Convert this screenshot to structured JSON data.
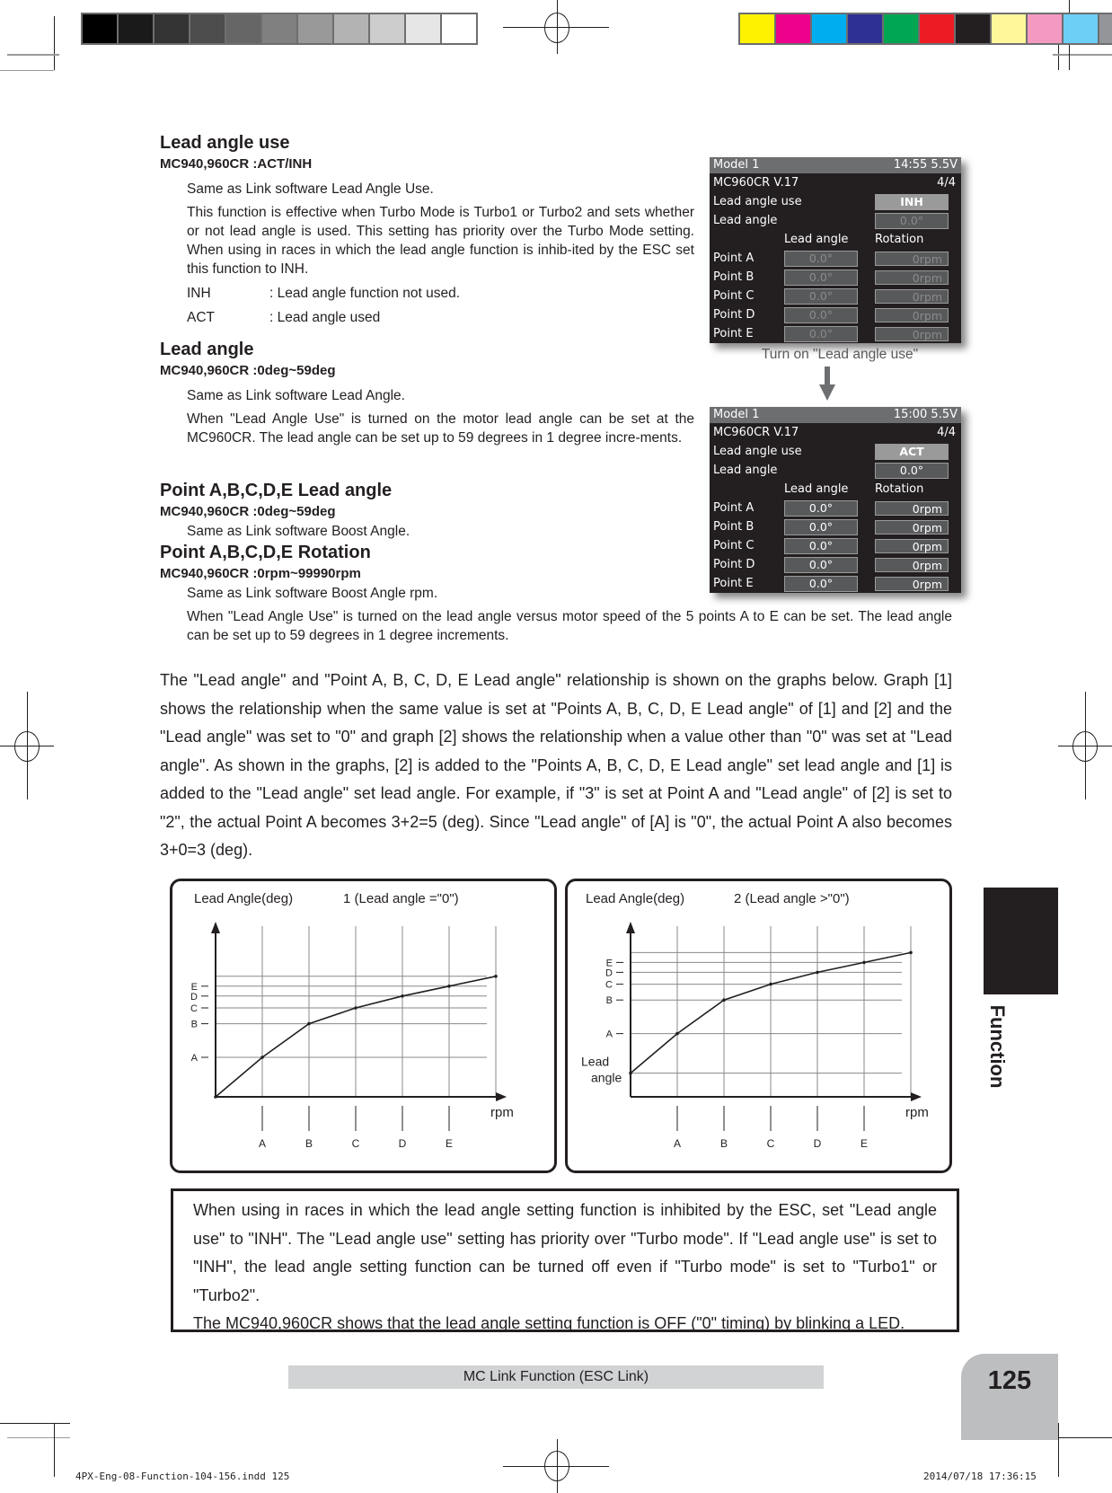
{
  "printer_marks": {
    "gray_steps": [
      "#000000",
      "#1a1a1a",
      "#333333",
      "#4d4d4d",
      "#666666",
      "#808080",
      "#999999",
      "#b3b3b3",
      "#cccccc",
      "#e6e6e6",
      "#ffffff"
    ],
    "color_steps": [
      "#fff200",
      "#ec008c",
      "#00aeef",
      "#2e3192",
      "#00a651",
      "#ed1c24",
      "#231f20",
      "#fff799",
      "#f49ac1",
      "#6dcff6",
      "#939598"
    ]
  },
  "sections": {
    "lead_angle_use": {
      "title": "Lead angle use",
      "spec": "MC940,960CR :ACT/INH",
      "p1": "Same as Link software Lead Angle Use.",
      "p2": "This function is effective when Turbo Mode is Turbo1 or Turbo2 and sets whether or not lead angle is used. This setting has priority over the Turbo Mode setting. When using in races in which the lead angle function is inhib-ited by the ESC set this function to INH.",
      "opt_inh_key": "INH",
      "opt_inh_val": ": Lead angle function not used.",
      "opt_act_key": "ACT",
      "opt_act_val": ": Lead angle used"
    },
    "lead_angle": {
      "title": "Lead angle",
      "spec": "MC940,960CR :0deg~59deg",
      "p1": "Same as Link software Lead Angle.",
      "p2": "When \"Lead Angle Use\" is turned on the motor lead angle can be set at the MC960CR. The lead angle can be set up to 59 degrees in 1 degree incre-ments."
    },
    "point_lead_angle": {
      "title": "Point A,B,C,D,E Lead angle",
      "spec": "MC940,960CR :0deg~59deg",
      "p1": "Same as Link software Boost Angle."
    },
    "point_rotation": {
      "title": "Point A,B,C,D,E Rotation",
      "spec": "MC940,960CR :0rpm~99990rpm",
      "p1": "Same as Link software Boost Angle rpm.",
      "p2": "When \"Lead Angle Use\" is turned on the lead angle versus motor speed of the 5 points A to E can be set. The lead angle can be set up to 59 degrees in 1 degree increments."
    },
    "relationship": "The \"Lead angle\" and \"Point A, B, C, D, E Lead angle\" relationship is shown on the graphs below. Graph [1] shows the relationship when the same value is set at \"Points A, B, C, D, E Lead angle\" of [1] and [2] and the \"Lead angle\" was set to \"0\" and graph [2] shows the relationship when a value other than \"0\" was set at \"Lead angle\". As shown in the graphs, [2] is added to the \"Points A, B, C, D, E Lead angle\" set lead angle and [1] is added to the \"Lead angle\" set lead angle. For example, if \"3\" is set at Point A and \"Lead angle\" of [2] is set to \"2\", the actual Point A  becomes 3+2=5 (deg). Since \"Lead angle\" of [A] is \"0\", the actual Point A also becomes 3+0=3 (deg)."
  },
  "screens": [
    {
      "model": "Model 1",
      "status": "14:55 5.5V",
      "device": "MC960CR V.17",
      "page": "4/4",
      "lead_angle_use_label": "Lead angle use",
      "lead_angle_use_value": "INH",
      "lead_angle_label": "Lead angle",
      "lead_angle_value": "0.0°",
      "col_lead": "Lead angle",
      "col_rot": "Rotation",
      "points": [
        {
          "label": "Point A",
          "angle": "0.0°",
          "rpm": "0rpm"
        },
        {
          "label": "Point B",
          "angle": "0.0°",
          "rpm": "0rpm"
        },
        {
          "label": "Point C",
          "angle": "0.0°",
          "rpm": "0rpm"
        },
        {
          "label": "Point D",
          "angle": "0.0°",
          "rpm": "0rpm"
        },
        {
          "label": "Point E",
          "angle": "0.0°",
          "rpm": "0rpm"
        }
      ]
    },
    {
      "model": "Model 1",
      "status": "15:00 5.5V",
      "device": "MC960CR V.17",
      "page": "4/4",
      "lead_angle_use_label": "Lead angle use",
      "lead_angle_use_value": "ACT",
      "lead_angle_label": "Lead angle",
      "lead_angle_value": "0.0°",
      "col_lead": "Lead angle",
      "col_rot": "Rotation",
      "points": [
        {
          "label": "Point A",
          "angle": "0.0°",
          "rpm": "0rpm"
        },
        {
          "label": "Point B",
          "angle": "0.0°",
          "rpm": "0rpm"
        },
        {
          "label": "Point C",
          "angle": "0.0°",
          "rpm": "0rpm"
        },
        {
          "label": "Point D",
          "angle": "0.0°",
          "rpm": "0rpm"
        },
        {
          "label": "Point E",
          "angle": "0.0°",
          "rpm": "0rpm"
        }
      ]
    }
  ],
  "screen_caption": "Turn on \"Lead angle use\"",
  "chart_data": [
    {
      "type": "line",
      "title": "1 (Lead angle =\"0\")",
      "ylabel": "Lead Angle(deg)",
      "xlabel": "rpm",
      "x_ticks": [
        "A",
        "B",
        "C",
        "D",
        "E"
      ],
      "y_ticks": [
        "A",
        "B",
        "C",
        "D",
        "E"
      ],
      "y_offset_label": "",
      "points": [
        [
          0,
          0
        ],
        [
          1,
          1
        ],
        [
          2,
          2
        ],
        [
          3,
          3
        ],
        [
          4,
          4
        ],
        [
          5,
          5
        ],
        [
          6,
          6
        ]
      ],
      "y_levels": [
        0,
        1.0,
        1.85,
        2.25,
        2.55,
        2.8,
        3.05
      ],
      "grid": true
    },
    {
      "type": "line",
      "title": "2 (Lead angle >\"0\")",
      "ylabel": "Lead Angle(deg)",
      "xlabel": "rpm",
      "x_ticks": [
        "A",
        "B",
        "C",
        "D",
        "E"
      ],
      "y_ticks": [
        "A",
        "B",
        "C",
        "D",
        "E"
      ],
      "y_offset_label": "Lead\nangle",
      "y_levels": [
        0.6,
        1.6,
        2.45,
        2.85,
        3.15,
        3.4,
        3.65
      ],
      "grid": true
    }
  ],
  "note": {
    "p1": "When using in races in which the lead angle setting function is inhibited by the ESC, set \"Lead angle use\" to \"INH\". The \"Lead angle use\" setting has priority over \"Turbo mode\". If \"Lead angle use\" is set to \"INH\", the lead angle setting function can be turned off even if \"Turbo mode\" is set to \"Turbo1\" or \"Turbo2\".",
    "p2": "The MC940,960CR shows that the lead angle setting function is OFF (\"0\" timing) by blinking a LED."
  },
  "footer": {
    "section": "MC Link Function  (ESC Link)",
    "page_number": "125",
    "side_tab": "Function",
    "slug_left": "4PX-Eng-08-Function-104-156.indd   125",
    "slug_right": "2014/07/18   17:36:15"
  }
}
